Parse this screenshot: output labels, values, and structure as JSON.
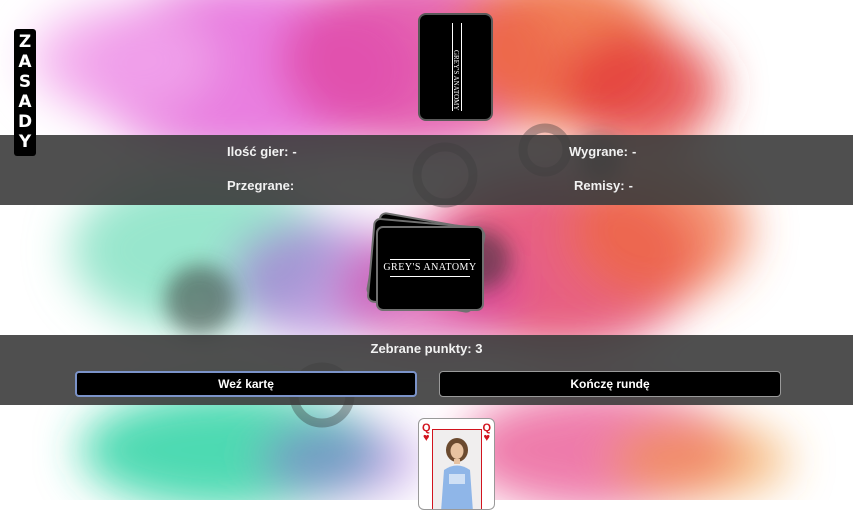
{
  "rules": {
    "letters": [
      "Z",
      "A",
      "S",
      "A",
      "D",
      "Y"
    ]
  },
  "opponent_card": {
    "title": "GREY'S ANATOMY"
  },
  "stats": {
    "games_label": "Ilość gier:",
    "games_value": "-",
    "wins_label": "Wygrane:",
    "wins_value": "-",
    "losses_label": "Przegrane:",
    "draws_label": "Remisy:",
    "draws_value": "-"
  },
  "deck": {
    "title": "GREY'S ANATOMY"
  },
  "actions": {
    "points_label": "Zebrane punkty:",
    "points_value": "3",
    "take_card": "Weź kartę",
    "end_round": "Kończę rundę"
  },
  "player_card": {
    "rank": "Q",
    "suit": "♥"
  }
}
